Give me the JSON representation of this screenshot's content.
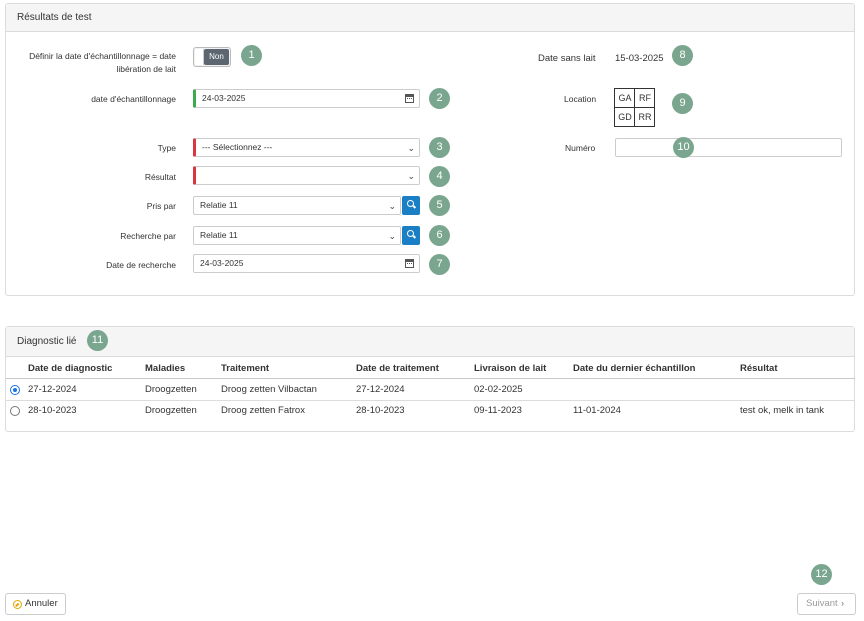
{
  "test_results": {
    "title": "Résultats de test",
    "sampling_toggle": {
      "label_line1": "Définir la date d'échantillonnage = date",
      "label_line2": "libération de lait",
      "value": "Non"
    },
    "sampling_date": {
      "label": "date d'échantillonnage",
      "value": "24-03-2025"
    },
    "type": {
      "label": "Type",
      "value": "--- Sélectionnez ---"
    },
    "result": {
      "label": "Résultat",
      "value": ""
    },
    "taken_by": {
      "label": "Pris par",
      "value": "Relatie 11"
    },
    "searched_by": {
      "label": "Recherche par",
      "value": "Relatie 11"
    },
    "search_date": {
      "label": "Date de recherche",
      "value": "24-03-2025"
    },
    "milk_free_date": {
      "label": "Date sans lait",
      "value": "15-03-2025"
    },
    "location": {
      "label": "Location",
      "cells": [
        "GA",
        "RF",
        "GD",
        "RR"
      ]
    },
    "number": {
      "label": "Numéro",
      "value": ""
    }
  },
  "diagnosis": {
    "title": "Diagnostic lié",
    "columns": [
      "Date de diagnostic",
      "Maladies",
      "Traitement",
      "Date de traitement",
      "Livraison de lait",
      "Date du dernier échantillon",
      "Résultat"
    ],
    "rows": [
      {
        "selected": true,
        "cells": [
          "27-12-2024",
          "Droogzetten",
          "Droog zetten Vilbactan",
          "27-12-2024",
          "02-02-2025",
          "",
          ""
        ]
      },
      {
        "selected": false,
        "cells": [
          "28-10-2023",
          "Droogzetten",
          "Droog zetten Fatrox",
          "28-10-2023",
          "09-11-2023",
          "11-01-2024",
          "test ok, melk in tank"
        ]
      }
    ]
  },
  "footer": {
    "cancel_label": "Annuler",
    "next_label": "Suivant"
  },
  "badges": [
    "1",
    "2",
    "3",
    "4",
    "5",
    "6",
    "7",
    "8",
    "9",
    "10",
    "11",
    "12"
  ],
  "colors": {
    "badge": "#7aa58e",
    "required_marker": "#d9363e",
    "valid_marker": "#3daa4d",
    "search_button": "#1a7fc4",
    "toggle_off": "#5b6670"
  },
  "icons": {
    "calendar": "calendar-icon",
    "search": "search-icon",
    "chevron": "chevron-down-icon",
    "cancel": "cancel-icon",
    "next": "chevron-right-icon"
  }
}
